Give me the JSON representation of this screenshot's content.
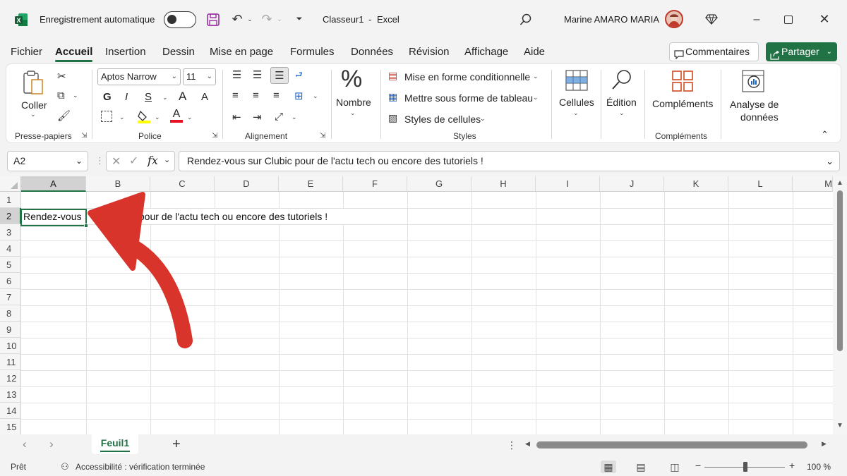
{
  "titlebar": {
    "autosave_label": "Enregistrement automatique",
    "doc_title": "Classeur1",
    "separator": "-",
    "app_name": "Excel",
    "user_name": "Marine AMARO MARIA"
  },
  "menu": {
    "tabs": [
      "Fichier",
      "Accueil",
      "Insertion",
      "Dessin",
      "Mise en page",
      "Formules",
      "Données",
      "Révision",
      "Affichage",
      "Aide"
    ],
    "active_index": 1,
    "comments_label": "Commentaires",
    "share_label": "Partager"
  },
  "ribbon": {
    "clipboard": {
      "paste_label": "Coller",
      "group_label": "Presse-papiers"
    },
    "font": {
      "font_name": "Aptos Narrow",
      "font_size": "11",
      "bold": "G",
      "italic": "I",
      "underline": "S",
      "grow": "A",
      "shrink": "A",
      "color_a": "A",
      "group_label": "Police"
    },
    "alignment": {
      "group_label": "Alignement"
    },
    "number": {
      "label": "Nombre"
    },
    "styles": {
      "conditional": "Mise en forme conditionnelle",
      "as_table": "Mettre sous forme de tableau",
      "cell_styles": "Styles de cellules",
      "group_label": "Styles"
    },
    "cells": {
      "label": "Cellules"
    },
    "editing": {
      "label": "Édition"
    },
    "addins": {
      "label": "Compléments",
      "group_label": "Compléments"
    },
    "analyze": {
      "label_line1": "Analyse de",
      "label_line2": "données"
    }
  },
  "formula_bar": {
    "name_box": "A2",
    "fx": "fx",
    "content": "Rendez-vous sur Clubic pour de l'actu tech ou encore des tutoriels !"
  },
  "grid": {
    "columns": [
      "A",
      "B",
      "C",
      "D",
      "E",
      "F",
      "G",
      "H",
      "I",
      "J",
      "K",
      "L",
      "M"
    ],
    "rows": [
      "1",
      "2",
      "3",
      "4",
      "5",
      "6",
      "7",
      "8",
      "9",
      "10",
      "11",
      "12",
      "13",
      "14",
      "15"
    ],
    "cell_a2_visible": "Rendez-vous",
    "cell_a2_overflow_visible": "c pour de l'actu tech ou encore des tutoriels !",
    "active_column": "A",
    "active_row": "2"
  },
  "sheets": {
    "tabs": [
      "Feuil1"
    ],
    "add_label": "+"
  },
  "status": {
    "ready": "Prêt",
    "accessibility": "Accessibilité : vérification terminée",
    "zoom": "100 %"
  },
  "colors": {
    "accent": "#217346",
    "arrow": "#d9342b"
  }
}
